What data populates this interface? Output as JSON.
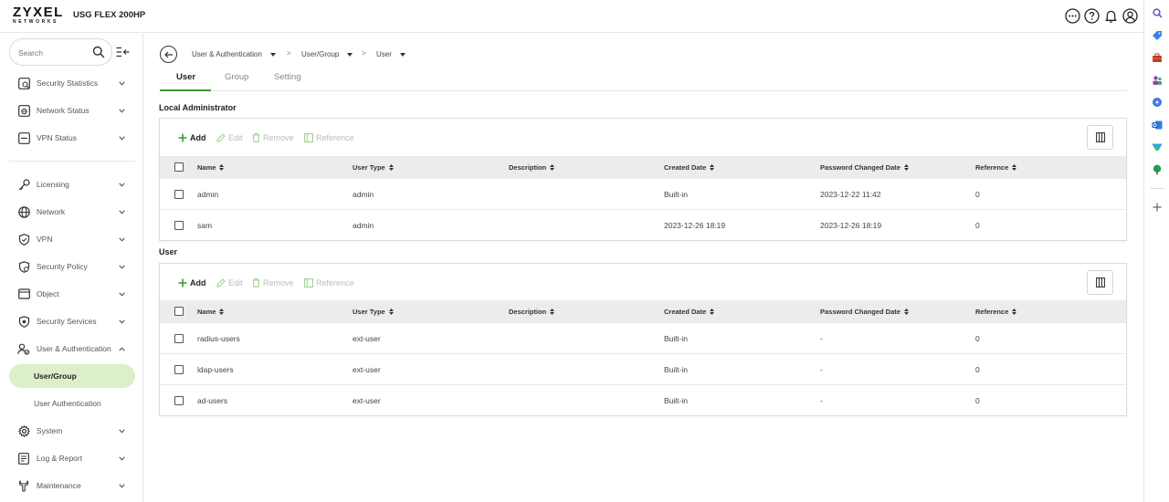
{
  "header": {
    "logo_main": "ZYXEL",
    "logo_sub": "NETWORKS",
    "model": "USG FLEX 200HP"
  },
  "sidebar": {
    "search_placeholder": "Search",
    "items": [
      {
        "label": "Security Statistics",
        "icon": "chart-icon"
      },
      {
        "label": "Network Status",
        "icon": "network-status-icon"
      },
      {
        "label": "VPN Status",
        "icon": "vpn-status-icon"
      },
      {
        "label": "Licensing",
        "icon": "key-icon"
      },
      {
        "label": "Network",
        "icon": "globe-icon"
      },
      {
        "label": "VPN",
        "icon": "shield-icon"
      },
      {
        "label": "Security Policy",
        "icon": "security-policy-icon"
      },
      {
        "label": "Object",
        "icon": "object-icon"
      },
      {
        "label": "Security Services",
        "icon": "security-services-icon"
      },
      {
        "label": "User & Authentication",
        "icon": "users-icon"
      },
      {
        "label": "System",
        "icon": "gear-icon"
      },
      {
        "label": "Log & Report",
        "icon": "log-icon"
      },
      {
        "label": "Maintenance",
        "icon": "wrench-icon"
      }
    ],
    "sub_items": [
      {
        "label": "User/Group",
        "active": true
      },
      {
        "label": "User Authentication",
        "active": false
      }
    ]
  },
  "breadcrumb": {
    "items": [
      "User & Authentication",
      "User/Group",
      "User"
    ],
    "separator": ">"
  },
  "tabs": [
    "User",
    "Group",
    "Setting"
  ],
  "toolbar": {
    "add": "Add",
    "edit": "Edit",
    "remove": "Remove",
    "reference": "Reference"
  },
  "columns": [
    "Name",
    "User Type",
    "Description",
    "Created Date",
    "Password Changed Date",
    "Reference"
  ],
  "local_admin": {
    "title": "Local Administrator",
    "rows": [
      {
        "name": "admin",
        "type": "admin",
        "description": "",
        "created": "Built-in",
        "pwd_changed": "2023-12-22 11:42",
        "reference": "0"
      },
      {
        "name": "sam",
        "type": "admin",
        "description": "",
        "created": "2023-12-26 18:19",
        "pwd_changed": "2023-12-26 18:19",
        "reference": "0"
      }
    ]
  },
  "users": {
    "title": "User",
    "rows": [
      {
        "name": "radius-users",
        "type": "ext-user",
        "description": "",
        "created": "Built-in",
        "pwd_changed": "-",
        "reference": "0"
      },
      {
        "name": "ldap-users",
        "type": "ext-user",
        "description": "",
        "created": "Built-in",
        "pwd_changed": "-",
        "reference": "0"
      },
      {
        "name": "ad-users",
        "type": "ext-user",
        "description": "",
        "created": "Built-in",
        "pwd_changed": "-",
        "reference": "0"
      }
    ]
  },
  "colors": {
    "accent_green": "#3b9a2f",
    "active_nav_bg": "#dcefc8",
    "table_header_bg": "#ececec"
  }
}
